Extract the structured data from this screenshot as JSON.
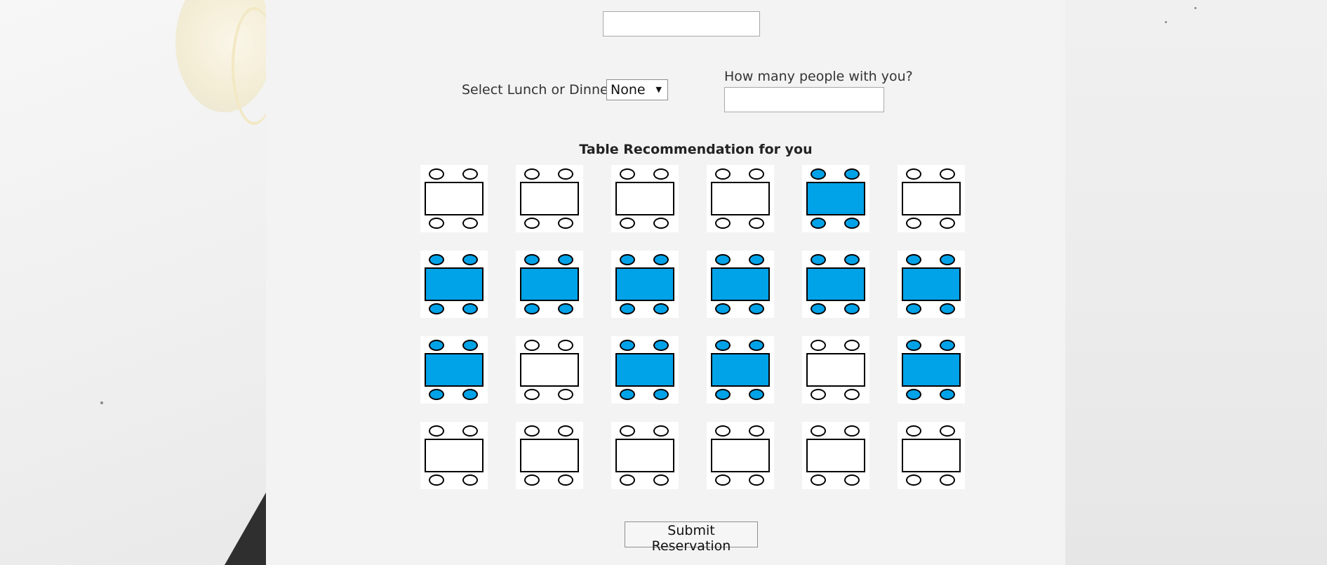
{
  "colors": {
    "reserved": "#00a2e8",
    "available": "#ffffff",
    "panel_background": "#f3f3f3"
  },
  "form": {
    "name_value": "",
    "meal_label": "Select Lunch or Dinner",
    "meal_selected": "None",
    "meal_arrow_icon": "triangle-down-icon",
    "people_label": "How many people with you?",
    "people_value": ""
  },
  "recommendation": {
    "title": "Table Recommendation for you",
    "rows": [
      [
        "available",
        "available",
        "available",
        "available",
        "reserved",
        "available"
      ],
      [
        "reserved",
        "reserved",
        "reserved",
        "reserved",
        "reserved",
        "reserved"
      ],
      [
        "reserved",
        "available",
        "reserved",
        "reserved",
        "available",
        "reserved"
      ],
      [
        "available",
        "available",
        "available",
        "available",
        "available",
        "available"
      ]
    ]
  },
  "submit": {
    "label": "Submit Reservation"
  }
}
